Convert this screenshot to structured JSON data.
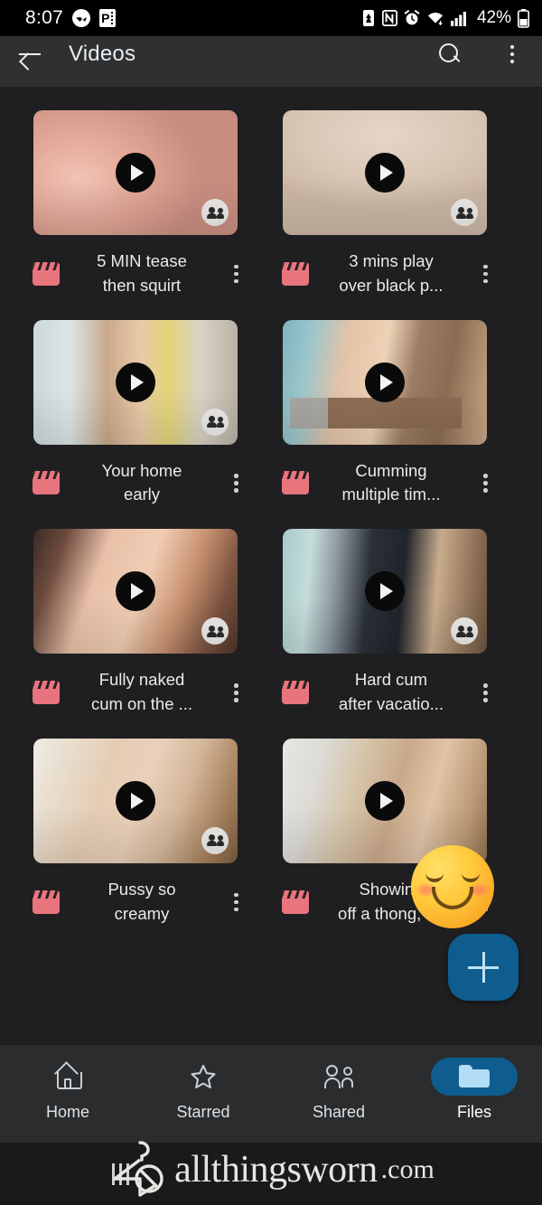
{
  "status_bar": {
    "time": "8:07",
    "battery_percent": "42%",
    "icons": [
      "messenger-icon",
      "p-badge-icon",
      "battery-saver-icon",
      "nfc-icon",
      "alarm-icon",
      "wifi-icon",
      "cellular-signal-icon",
      "battery-icon"
    ]
  },
  "app_bar": {
    "title": "Videos",
    "back_icon": "back-arrow-icon",
    "search_icon": "search-icon",
    "overflow_icon": "kebab-menu-icon"
  },
  "videos": [
    {
      "title_line1": "5 MIN tease",
      "title_line2": "then squirt",
      "shared": true,
      "thumb_class": "t1",
      "censored": false
    },
    {
      "title_line1": "3 mins play",
      "title_line2": "over black p...",
      "shared": true,
      "thumb_class": "t2",
      "censored": false
    },
    {
      "title_line1": "Your home",
      "title_line2": "early",
      "shared": true,
      "thumb_class": "t3",
      "censored": false
    },
    {
      "title_line1": "Cumming",
      "title_line2": "multiple tim...",
      "shared": false,
      "thumb_class": "t4",
      "censored": true
    },
    {
      "title_line1": "Fully naked",
      "title_line2": "cum on the ...",
      "shared": true,
      "thumb_class": "t5",
      "censored": false
    },
    {
      "title_line1": "Hard cum",
      "title_line2": "after vacatio...",
      "shared": true,
      "thumb_class": "t6",
      "censored": false
    },
    {
      "title_line1": "Pussy so",
      "title_line2": "creamy",
      "shared": true,
      "thumb_class": "t7",
      "censored": false
    },
    {
      "title_line1": "Showing",
      "title_line2": "off a thong, t...",
      "shared": false,
      "thumb_class": "t8",
      "censored": false
    }
  ],
  "fab": {
    "icon": "plus-icon",
    "label": ""
  },
  "overlay_sticker": {
    "icon": "smiling-face-with-smiling-eyes-emoji"
  },
  "bottom_nav": {
    "items": [
      {
        "label": "Home",
        "icon": "home-icon",
        "active": false
      },
      {
        "label": "Starred",
        "icon": "star-icon",
        "active": false
      },
      {
        "label": "Shared",
        "icon": "people-icon",
        "active": false
      },
      {
        "label": "Files",
        "icon": "folder-icon",
        "active": true
      }
    ],
    "active_pill_color": "#0f5d8e"
  },
  "watermark": {
    "brand": "allthingsworn",
    "suffix": ".com",
    "logo": "clothes-hanger-logo"
  },
  "android_nav": {
    "recents_icon": "recents-button"
  },
  "colors": {
    "background": "#1f1f21",
    "app_bar": "#2e3032",
    "bottom_nav": "#2a2c2e",
    "accent_blue": "#0f5d8e",
    "video_icon_pink": "#e8757e",
    "text_primary": "#e9eaec"
  }
}
